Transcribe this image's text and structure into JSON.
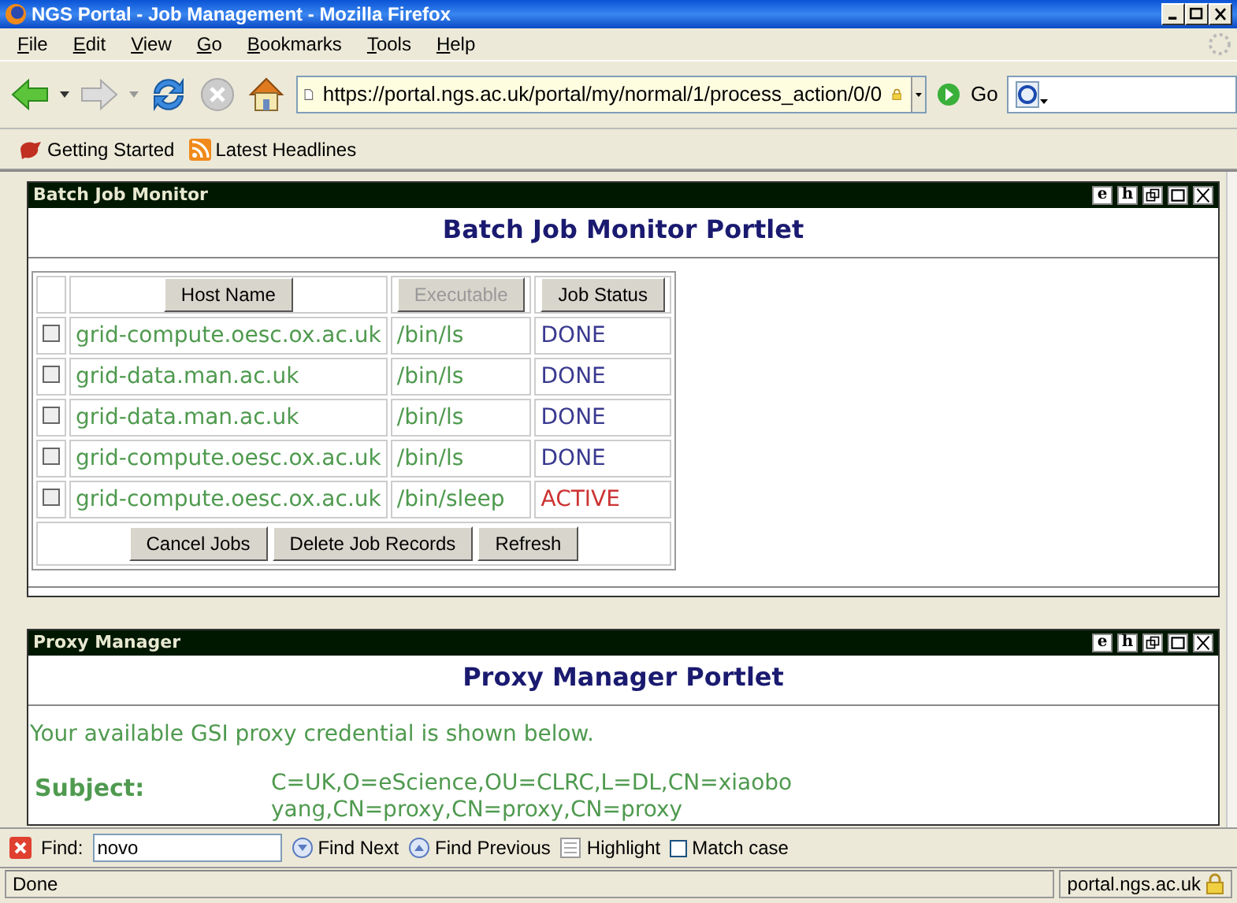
{
  "window": {
    "title": "NGS Portal - Job Management - Mozilla Firefox"
  },
  "menu": [
    "File",
    "Edit",
    "View",
    "Go",
    "Bookmarks",
    "Tools",
    "Help"
  ],
  "toolbar": {
    "url": "https://portal.ngs.ac.uk/portal/my/normal/1/process_action/0/0",
    "go_label": "Go"
  },
  "bookmarks": [
    "Getting Started",
    "Latest Headlines"
  ],
  "batch_portlet": {
    "header": "Batch Job Monitor",
    "controls": [
      "e",
      "h"
    ],
    "title": "Batch Job Monitor Portlet",
    "columns": [
      {
        "label": "Host Name",
        "disabled": false
      },
      {
        "label": "Executable",
        "disabled": true
      },
      {
        "label": "Job Status",
        "disabled": false
      }
    ],
    "rows": [
      {
        "checked": false,
        "host": "grid-compute.oesc.ox.ac.uk",
        "executable": "/bin/ls",
        "status": "DONE",
        "kind": "done"
      },
      {
        "checked": false,
        "host": "grid-data.man.ac.uk",
        "executable": "/bin/ls",
        "status": "DONE",
        "kind": "done"
      },
      {
        "checked": false,
        "host": "grid-data.man.ac.uk",
        "executable": "/bin/ls",
        "status": "DONE",
        "kind": "done"
      },
      {
        "checked": false,
        "host": "grid-compute.oesc.ox.ac.uk",
        "executable": "/bin/ls",
        "status": "DONE",
        "kind": "done"
      },
      {
        "checked": false,
        "host": "grid-compute.oesc.ox.ac.uk",
        "executable": "/bin/sleep",
        "status": "ACTIVE",
        "kind": "active"
      }
    ],
    "actions": [
      "Cancel Jobs",
      "Delete Job Records",
      "Refresh"
    ]
  },
  "proxy_portlet": {
    "header": "Proxy Manager",
    "controls": [
      "e",
      "h"
    ],
    "title": "Proxy Manager Portlet",
    "intro": "Your available GSI proxy credential is shown below.",
    "subject_label": "Subject:",
    "subject_value": "C=UK,O=eScience,OU=CLRC,L=DL,CN=xiaobo yang,CN=proxy,CN=proxy,CN=proxy"
  },
  "find_bar": {
    "label": "Find:",
    "value": "novo",
    "next": "Find Next",
    "previous": "Find Previous",
    "highlight": "Highlight",
    "match_case": {
      "label": "Match case",
      "checked": false
    }
  },
  "status_bar": {
    "text": "Done",
    "host": "portal.ngs.ac.uk"
  }
}
